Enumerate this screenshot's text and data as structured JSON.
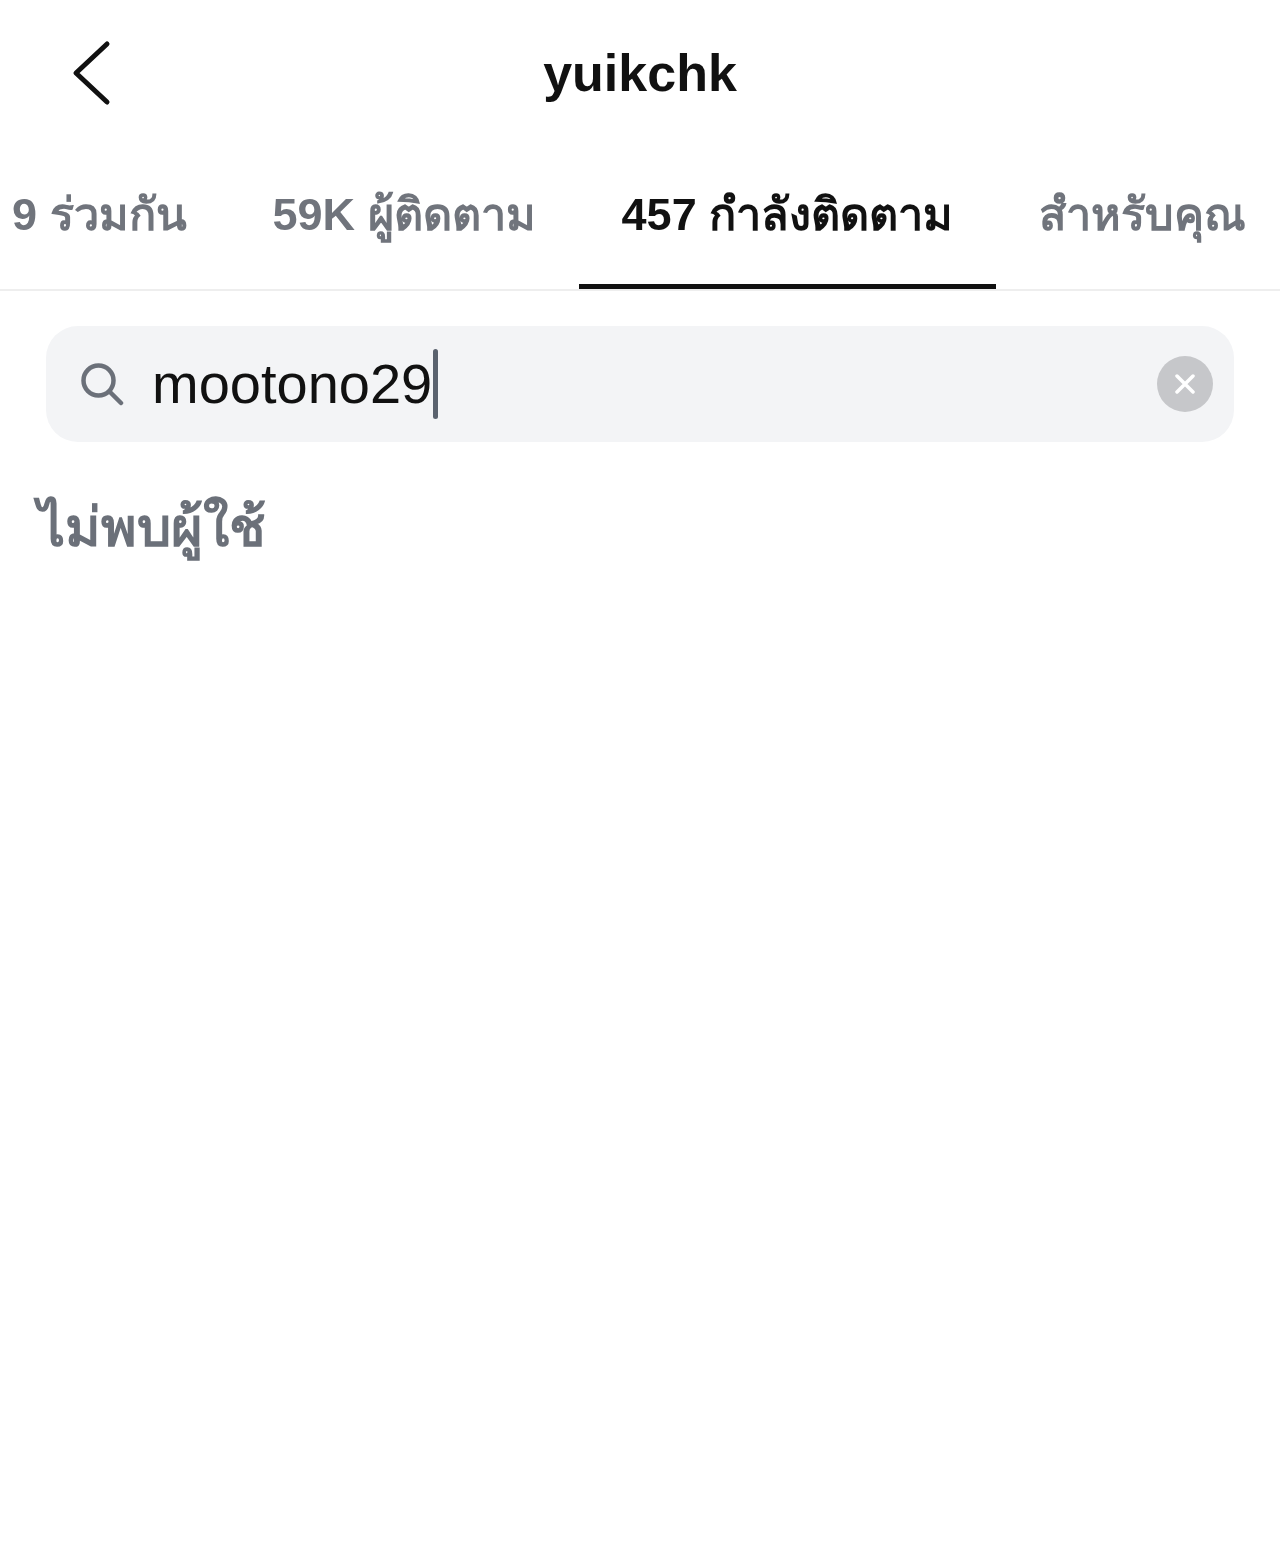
{
  "header": {
    "title": "yuikchk"
  },
  "tabs": [
    {
      "label": "9 ร่วมกัน",
      "selected": false
    },
    {
      "label": "59K ผู้ติดตาม",
      "selected": false
    },
    {
      "label": "457 กำลังติดตาม",
      "selected": true
    },
    {
      "label": "สำหรับคุณ",
      "selected": false
    }
  ],
  "search": {
    "value": "mootono29",
    "focused": true
  },
  "empty_message": "ไม่พบผู้ใช้"
}
